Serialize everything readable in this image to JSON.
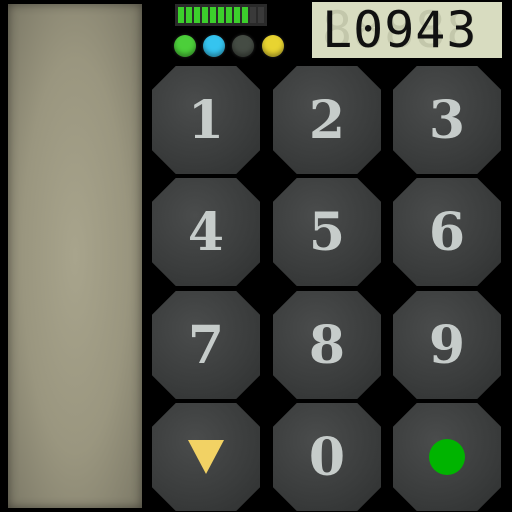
{
  "display": {
    "code": "L0943",
    "ghost": "88888"
  },
  "signal": {
    "segments_total": 11,
    "segments_on": 9,
    "on_color": "#3ccf2c"
  },
  "indicators": [
    {
      "name": "green",
      "color": "#4ccf3a"
    },
    {
      "name": "cyan",
      "color": "#35c4ef"
    },
    {
      "name": "dark",
      "color": "#454c44"
    },
    {
      "name": "yellow",
      "color": "#e8d431"
    }
  ],
  "keypad": {
    "keys": [
      "1",
      "2",
      "3",
      "4",
      "5",
      "6",
      "7",
      "8",
      "9",
      "0"
    ],
    "down_icon": "down-triangle-icon",
    "down_color": "#f2d264",
    "confirm_icon": "green-dot-icon",
    "confirm_color": "#00b400"
  }
}
